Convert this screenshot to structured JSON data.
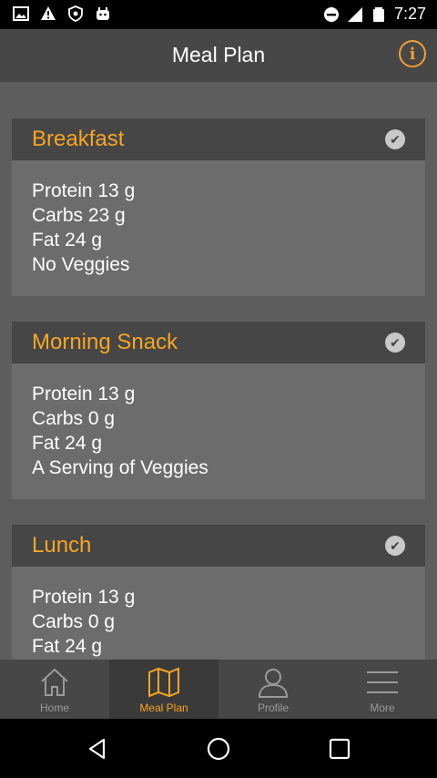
{
  "status_bar": {
    "time": "7:27",
    "left_icons": [
      "image-icon",
      "warning-icon",
      "shield-icon",
      "android-icon"
    ],
    "right_icons": [
      "dnd-icon",
      "signal-icon",
      "battery-icon"
    ]
  },
  "app_bar": {
    "title": "Meal Plan",
    "info_label": "i"
  },
  "meals": [
    {
      "name": "Breakfast",
      "lines": [
        "Protein 13 g",
        "Carbs 23 g",
        "Fat 24 g",
        "No Veggies"
      ],
      "completed": true
    },
    {
      "name": "Morning Snack",
      "lines": [
        "Protein 13 g",
        "Carbs 0 g",
        "Fat 24 g",
        "A Serving of Veggies"
      ],
      "completed": true
    },
    {
      "name": "Lunch",
      "lines": [
        "Protein 13 g",
        "Carbs 0 g",
        "Fat 24 g"
      ],
      "completed": true
    }
  ],
  "bottom_nav": [
    {
      "label": "Home",
      "icon": "home-icon",
      "active": false
    },
    {
      "label": "Meal Plan",
      "icon": "map-icon",
      "active": true
    },
    {
      "label": "Profile",
      "icon": "person-icon",
      "active": false
    },
    {
      "label": "More",
      "icon": "menu-icon",
      "active": false
    }
  ],
  "colors": {
    "accent": "#f5a623",
    "app_bar": "#474747",
    "background": "#5d5d5d"
  }
}
